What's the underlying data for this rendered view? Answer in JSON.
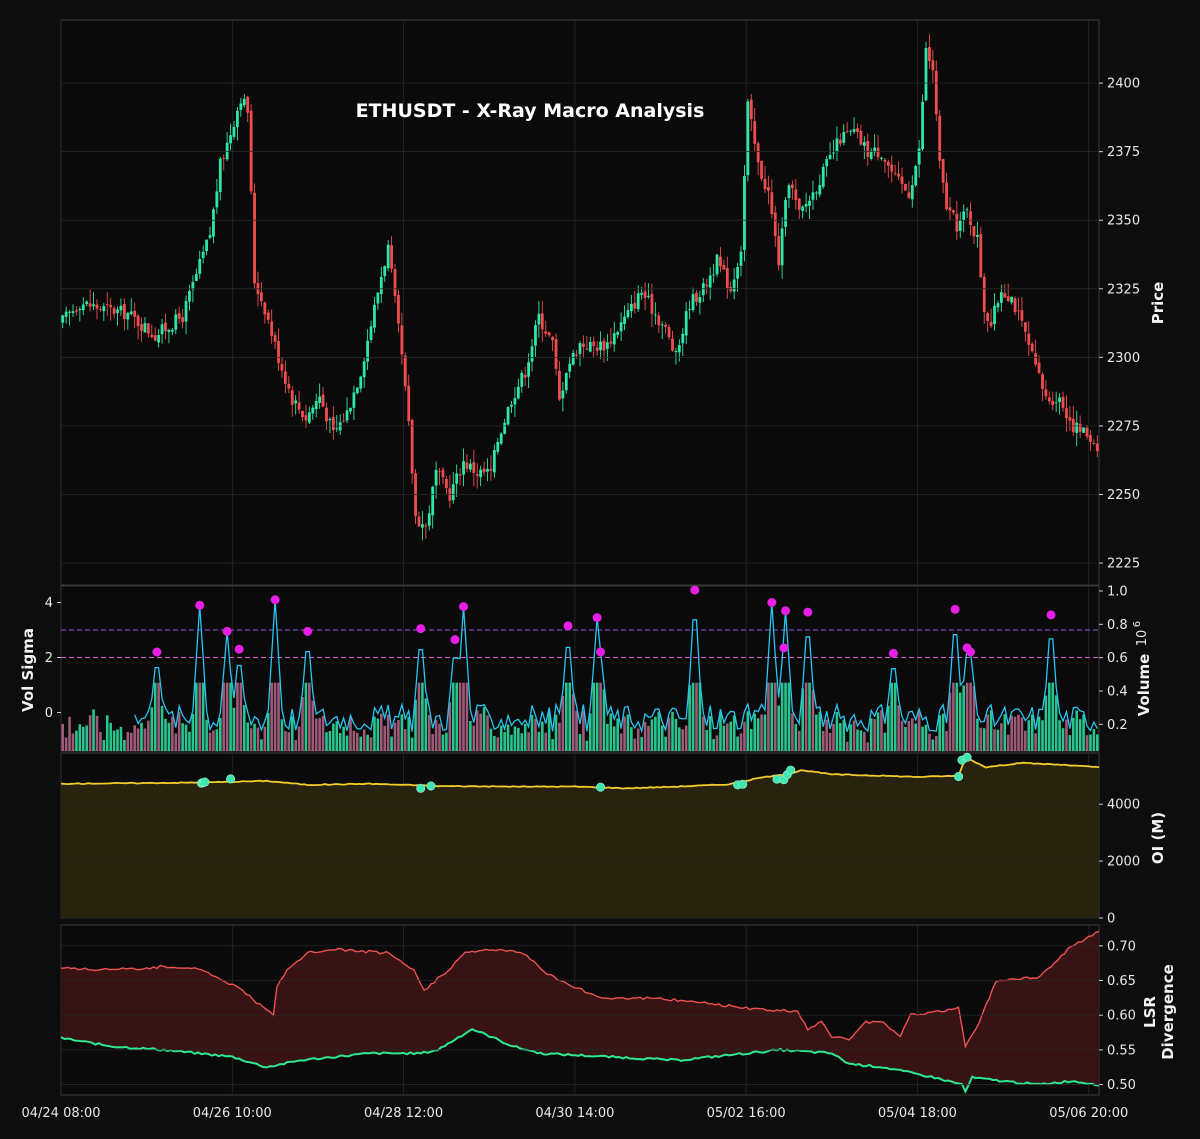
{
  "colors": {
    "background": "#0d0d0d",
    "panel": "#0a0a0a",
    "border": "#3a3a3a",
    "grid": "#2a2a2a",
    "up": "#2ee6a6",
    "down": "#ef4d4d",
    "sigma": "#29c4f0",
    "spike": "#e61ee6",
    "oi_line": "#f2cc2a",
    "oi_fill": "#2a2610",
    "oi_marker": "#3ee6b0",
    "lsr_top": "#ef5050",
    "lsr_bottom": "#2ee890",
    "lsr_fill": "#3a1414",
    "ref_high": "#9a4ee8",
    "ref_low": "#e05fd0"
  },
  "chart_data": [
    {
      "type": "candlestick",
      "title": "ETHUSDT - X-Ray Macro Analysis",
      "ylabel": "Price",
      "ylim": [
        2217,
        2423
      ],
      "yticks": [
        "2225",
        "2250",
        "2275",
        "2300",
        "2325",
        "2350",
        "2375",
        "2400"
      ],
      "ytick_values": [
        2225,
        2250,
        2275,
        2300,
        2325,
        2350,
        2375,
        2400
      ],
      "x_range_hours": [
        0,
        303
      ],
      "close_anchors": [
        [
          0,
          2312
        ],
        [
          6,
          2320
        ],
        [
          12,
          2318
        ],
        [
          20,
          2316
        ],
        [
          28,
          2308
        ],
        [
          36,
          2315
        ],
        [
          40,
          2330
        ],
        [
          44,
          2345
        ],
        [
          47,
          2370
        ],
        [
          50,
          2382
        ],
        [
          53,
          2395
        ],
        [
          55,
          2390
        ],
        [
          57,
          2328
        ],
        [
          60,
          2318
        ],
        [
          64,
          2300
        ],
        [
          68,
          2285
        ],
        [
          72,
          2278
        ],
        [
          76,
          2286
        ],
        [
          80,
          2272
        ],
        [
          84,
          2280
        ],
        [
          88,
          2295
        ],
        [
          92,
          2318
        ],
        [
          94,
          2330
        ],
        [
          96,
          2340
        ],
        [
          98,
          2320
        ],
        [
          100,
          2300
        ],
        [
          102,
          2275
        ],
        [
          104,
          2242
        ],
        [
          107,
          2238
        ],
        [
          110,
          2258
        ],
        [
          114,
          2250
        ],
        [
          118,
          2262
        ],
        [
          122,
          2258
        ],
        [
          126,
          2258
        ],
        [
          128,
          2270
        ],
        [
          132,
          2285
        ],
        [
          136,
          2295
        ],
        [
          140,
          2315
        ],
        [
          144,
          2305
        ],
        [
          146,
          2284
        ],
        [
          148,
          2296
        ],
        [
          152,
          2305
        ],
        [
          156,
          2304
        ],
        [
          160,
          2305
        ],
        [
          166,
          2316
        ],
        [
          170,
          2324
        ],
        [
          174,
          2316
        ],
        [
          177,
          2310
        ],
        [
          180,
          2300
        ],
        [
          184,
          2320
        ],
        [
          188,
          2325
        ],
        [
          192,
          2335
        ],
        [
          196,
          2325
        ],
        [
          199,
          2340
        ],
        [
          201,
          2392
        ],
        [
          204,
          2370
        ],
        [
          207,
          2360
        ],
        [
          210,
          2335
        ],
        [
          213,
          2365
        ],
        [
          216,
          2352
        ],
        [
          220,
          2360
        ],
        [
          224,
          2370
        ],
        [
          228,
          2380
        ],
        [
          232,
          2382
        ],
        [
          236,
          2375
        ],
        [
          240,
          2375
        ],
        [
          244,
          2365
        ],
        [
          248,
          2360
        ],
        [
          251,
          2375
        ],
        [
          253,
          2412
        ],
        [
          255,
          2405
        ],
        [
          257,
          2370
        ],
        [
          259,
          2355
        ],
        [
          262,
          2348
        ],
        [
          265,
          2353
        ],
        [
          268,
          2343
        ],
        [
          270,
          2318
        ],
        [
          272,
          2312
        ],
        [
          275,
          2325
        ],
        [
          278,
          2322
        ],
        [
          280,
          2315
        ],
        [
          282,
          2308
        ],
        [
          284,
          2300
        ],
        [
          288,
          2285
        ],
        [
          292,
          2285
        ],
        [
          296,
          2275
        ],
        [
          300,
          2272
        ],
        [
          303,
          2268
        ]
      ]
    },
    {
      "type": "line",
      "ylabel": "Vol Sigma",
      "ylim": [
        -1.4,
        4.6
      ],
      "yticks": [
        "0",
        "2",
        "4"
      ],
      "ytick_values": [
        0,
        2,
        4
      ],
      "reference_lines": [
        3.0,
        2.0
      ],
      "baseline": -0.3,
      "series": [
        {
          "spikes": [
            [
              28.0,
              2.2
            ],
            [
              40.5,
              3.9
            ],
            [
              48.5,
              2.95
            ],
            [
              52.0,
              2.3
            ],
            [
              62.5,
              4.1
            ],
            [
              72.0,
              2.95
            ],
            [
              105.0,
              3.05
            ],
            [
              115.0,
              2.65
            ],
            [
              117.5,
              3.85
            ],
            [
              148.0,
              3.15
            ],
            [
              156.5,
              3.45
            ],
            [
              157.5,
              2.2
            ],
            [
              185.0,
              4.45
            ],
            [
              207.5,
              4.0
            ],
            [
              211.0,
              2.35
            ],
            [
              211.5,
              3.7
            ],
            [
              218.0,
              3.65
            ],
            [
              243.0,
              2.15
            ],
            [
              261.0,
              3.75
            ],
            [
              264.5,
              2.35
            ],
            [
              265.5,
              2.2
            ],
            [
              289.0,
              3.55
            ]
          ]
        }
      ],
      "volume": {
        "ylabel": "Volume",
        "multiplier": "10",
        "multiplier_exponent": "6",
        "ylim": [
          0.04,
          1.03
        ],
        "yticks": [
          "0.2",
          "0.4",
          "0.6",
          "0.8",
          "1.0"
        ],
        "ytick_values": [
          0.2,
          0.4,
          0.6,
          0.8,
          1.0
        ]
      }
    },
    {
      "type": "area",
      "ylabel": "OI (M)",
      "ylim": [
        0,
        5800
      ],
      "yticks": [
        "0",
        "2000",
        "4000"
      ],
      "ytick_values": [
        0,
        2000,
        4000
      ],
      "series": [
        {
          "anchors": [
            [
              0,
              4720
            ],
            [
              20,
              4740
            ],
            [
              40,
              4760
            ],
            [
              60,
              4820
            ],
            [
              72,
              4680
            ],
            [
              90,
              4720
            ],
            [
              110,
              4640
            ],
            [
              130,
              4620
            ],
            [
              150,
              4620
            ],
            [
              165,
              4560
            ],
            [
              180,
              4620
            ],
            [
              195,
              4700
            ],
            [
              205,
              4950
            ],
            [
              212,
              5050
            ],
            [
              216,
              5200
            ],
            [
              225,
              5050
            ],
            [
              240,
              5000
            ],
            [
              250,
              4960
            ],
            [
              262,
              5000
            ],
            [
              264,
              5650
            ],
            [
              270,
              5300
            ],
            [
              280,
              5450
            ],
            [
              290,
              5400
            ],
            [
              303,
              5300
            ]
          ],
          "markers": [
            [
              41.0,
              4740
            ],
            [
              41.5,
              4760
            ],
            [
              42.0,
              4780
            ],
            [
              49.5,
              4890
            ],
            [
              105.0,
              4560
            ],
            [
              108.0,
              4640
            ],
            [
              157.5,
              4600
            ],
            [
              197.5,
              4680
            ],
            [
              199.0,
              4700
            ],
            [
              209.0,
              4880
            ],
            [
              211.0,
              4860
            ],
            [
              212.0,
              5040
            ],
            [
              213.0,
              5200
            ],
            [
              262.0,
              4970
            ],
            [
              263.0,
              5550
            ],
            [
              264.5,
              5650
            ]
          ]
        }
      ]
    },
    {
      "type": "area",
      "ylabel": "LSR\nDivergence",
      "ylim": [
        0.485,
        0.73
      ],
      "yticks": [
        "0.50",
        "0.55",
        "0.60",
        "0.65",
        "0.70"
      ],
      "ytick_values": [
        0.5,
        0.55,
        0.6,
        0.65,
        0.7
      ],
      "series": [
        {
          "anchors": [
            [
              0,
              0.668
            ],
            [
              15,
              0.665
            ],
            [
              30,
              0.67
            ],
            [
              40,
              0.668
            ],
            [
              45,
              0.655
            ],
            [
              52,
              0.64
            ],
            [
              58,
              0.615
            ],
            [
              62,
              0.6
            ],
            [
              63,
              0.64
            ],
            [
              66,
              0.665
            ],
            [
              72,
              0.69
            ],
            [
              80,
              0.695
            ],
            [
              95,
              0.69
            ],
            [
              103,
              0.665
            ],
            [
              106,
              0.635
            ],
            [
              114,
              0.67
            ],
            [
              118,
              0.69
            ],
            [
              125,
              0.695
            ],
            [
              135,
              0.69
            ],
            [
              142,
              0.66
            ],
            [
              150,
              0.64
            ],
            [
              158,
              0.625
            ],
            [
              170,
              0.625
            ],
            [
              185,
              0.62
            ],
            [
              200,
              0.61
            ],
            [
              215,
              0.605
            ],
            [
              218,
              0.58
            ],
            [
              222,
              0.59
            ],
            [
              225,
              0.57
            ],
            [
              230,
              0.565
            ],
            [
              235,
              0.59
            ],
            [
              240,
              0.59
            ],
            [
              245,
              0.57
            ],
            [
              248,
              0.6
            ],
            [
              255,
              0.605
            ],
            [
              262,
              0.61
            ],
            [
              264,
              0.555
            ],
            [
              268,
              0.59
            ],
            [
              273,
              0.65
            ],
            [
              285,
              0.655
            ],
            [
              290,
              0.675
            ],
            [
              295,
              0.7
            ],
            [
              303,
              0.72
            ]
          ]
        },
        {
          "anchors": [
            [
              0,
              0.567
            ],
            [
              15,
              0.555
            ],
            [
              30,
              0.55
            ],
            [
              40,
              0.545
            ],
            [
              50,
              0.54
            ],
            [
              60,
              0.525
            ],
            [
              70,
              0.535
            ],
            [
              80,
              0.54
            ],
            [
              90,
              0.545
            ],
            [
              105,
              0.545
            ],
            [
              110,
              0.55
            ],
            [
              115,
              0.565
            ],
            [
              120,
              0.58
            ],
            [
              125,
              0.57
            ],
            [
              132,
              0.555
            ],
            [
              140,
              0.545
            ],
            [
              160,
              0.54
            ],
            [
              180,
              0.535
            ],
            [
              200,
              0.545
            ],
            [
              210,
              0.55
            ],
            [
              225,
              0.545
            ],
            [
              230,
              0.53
            ],
            [
              240,
              0.525
            ],
            [
              245,
              0.52
            ],
            [
              255,
              0.51
            ],
            [
              263,
              0.5
            ],
            [
              264,
              0.49
            ],
            [
              266,
              0.51
            ],
            [
              275,
              0.505
            ],
            [
              285,
              0.5
            ],
            [
              295,
              0.505
            ],
            [
              303,
              0.5
            ]
          ]
        }
      ]
    }
  ],
  "x_axis": {
    "ticks": [
      "04/24 08:00",
      "04/26 10:00",
      "04/28 12:00",
      "04/30 14:00",
      "05/02 16:00",
      "05/04 18:00",
      "05/06 20:00"
    ],
    "tick_hours": [
      0,
      50,
      100,
      150,
      200,
      250,
      300
    ]
  }
}
